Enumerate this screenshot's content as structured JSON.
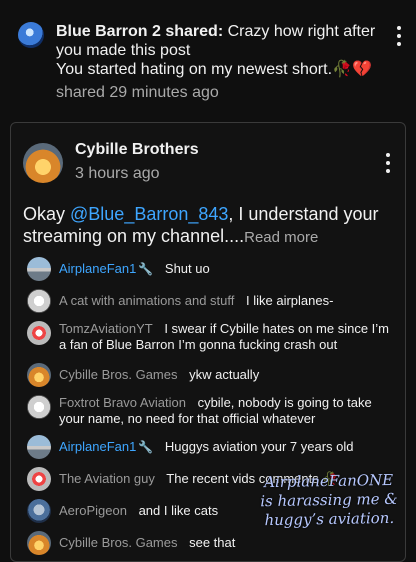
{
  "top_item": {
    "author": "Blue Barron 2 shared:",
    "text_line1": "Crazy how right after",
    "text_line2": "you made this post",
    "text_line3": "You started hating on my newest short.🥀💔",
    "timestamp": "shared 29 minutes ago",
    "avatar_icon": "avatar-icon"
  },
  "post": {
    "channel": "Cybille Brothers",
    "timestamp": "3 hours ago",
    "text_before": "Okay ",
    "mention": "@Blue_Barron_843",
    "text_after": ", I understand your streaming on my channel....",
    "read_more": "Read more"
  },
  "chat": [
    {
      "user": "AirplaneFan1",
      "badge": "🔧",
      "message": "Shut uo",
      "avatar": "plane"
    },
    {
      "user": "A cat with animations and stuff",
      "badge": "",
      "message": "I like airplanes-",
      "avatar": "white"
    },
    {
      "user": "TomzAviationYT",
      "badge": "",
      "message": "I swear if Cybille hates on me since I’m a fan of Blue Barron I’m gonna fucking crash out",
      "avatar": "redplane"
    },
    {
      "user": "Cybille Bros. Games",
      "badge": "",
      "message": "ykw actually",
      "avatar": "orange"
    },
    {
      "user": "Foxtrot Bravo Aviation",
      "badge": "",
      "message": "cybile, nobody is going to take your name, no need for that official whatever",
      "avatar": "white"
    },
    {
      "user": "AirplaneFan1",
      "badge": "🔧",
      "message": "Huggys aviation your 7 years old",
      "avatar": "plane"
    },
    {
      "user": "The Aviation guy",
      "badge": "",
      "message": "The recent vids comments 🥀",
      "avatar": "redplane"
    },
    {
      "user": "AeroPigeon",
      "badge": "",
      "message": "and I like cats",
      "avatar": "pigeon"
    },
    {
      "user": "Cybille Bros. Games",
      "badge": "",
      "message": "see that",
      "avatar": "orange"
    }
  ],
  "overlay": {
    "line1": "AirplaneFanONE",
    "line2": "is harassing me &",
    "line3": "huggy’s aviation."
  },
  "colors": {
    "background": "#0f0f0f",
    "mention": "#3ea6ff",
    "muted": "#aaaaaa"
  }
}
